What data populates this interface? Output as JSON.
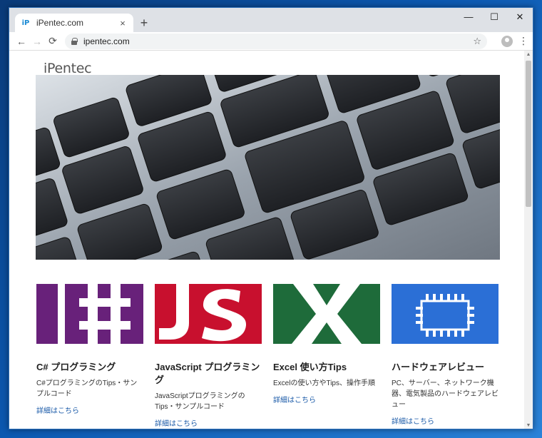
{
  "browser": {
    "tab_title": "iPentec.com",
    "favicon_text": "iP",
    "new_tab": "+",
    "tab_close": "×",
    "url": "ipentec.com",
    "controls": {
      "minimize": "—",
      "maximize": "☐",
      "close": "✕"
    },
    "nav": {
      "back": "←",
      "forward": "→",
      "reload": "⟳",
      "bookmark": "☆",
      "menu": "⋮"
    },
    "scroll_position": 0.0
  },
  "site": {
    "logo": "iPentec"
  },
  "cards": [
    {
      "title": "C# プログラミング",
      "desc": "C#プログラミングのTips・サンプルコード",
      "link": "詳細はこちら",
      "color": "#68217a"
    },
    {
      "title": "JavaScript プログラミング",
      "desc": "JavaScriptプログラミングのTips・サンプルコード",
      "link": "詳細はこちら",
      "color": "#c8102e"
    },
    {
      "title": "Excel 使い方Tips",
      "desc": "Excelの使い方やTips、操作手順",
      "link": "詳細はこちら",
      "color": "#1e6b3a"
    },
    {
      "title": "ハードウェアレビュー",
      "desc": "PC、サーバー、ネットワーク機器、電気製品のハードウェアレビュー",
      "link": "詳細はこちら",
      "color": "#2b6fd6"
    }
  ],
  "colors": {
    "desktop": "#0c58b0",
    "tabstrip": "#dee1e6",
    "link": "#1a5aa8"
  },
  "icons": [
    "back-arrow-icon",
    "forward-arrow-icon",
    "reload-icon",
    "lock-icon",
    "star-icon",
    "profile-icon",
    "kebab-menu-icon"
  ]
}
